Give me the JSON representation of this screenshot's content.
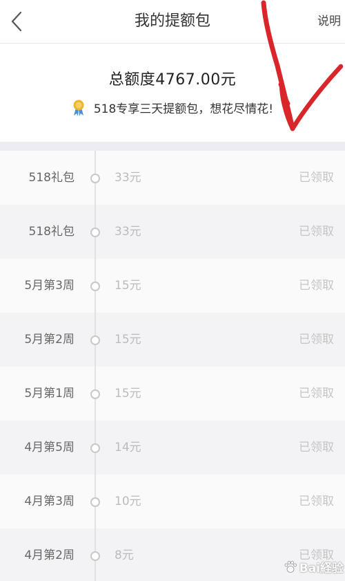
{
  "navbar": {
    "back_icon": "chevron-left-icon",
    "title": "我的提额包",
    "help_label": "说明"
  },
  "summary": {
    "total_label": "总额度4767.00元",
    "promo_icon": "medal-icon",
    "promo_text": "518专享三天提额包，想花尽情花!"
  },
  "packages": [
    {
      "label": "518礼包",
      "amount": "33元",
      "status": "已领取"
    },
    {
      "label": "518礼包",
      "amount": "33元",
      "status": "已领取"
    },
    {
      "label": "5月第3周",
      "amount": "15元",
      "status": "已领取"
    },
    {
      "label": "5月第2周",
      "amount": "15元",
      "status": "已领取"
    },
    {
      "label": "5月第1周",
      "amount": "15元",
      "status": "已领取"
    },
    {
      "label": "4月第5周",
      "amount": "14元",
      "status": "已领取"
    },
    {
      "label": "4月第3周",
      "amount": "10元",
      "status": "已领取"
    },
    {
      "label": "4月第2周",
      "amount": "8元",
      "status": "已领取"
    }
  ],
  "annotation": {
    "type": "red-arrow-icon",
    "color": "#d8262a"
  },
  "watermark": {
    "text": "Bai経验"
  },
  "colors": {
    "background": "#ffffff",
    "list_bg_alt": "#f3f3f5",
    "muted_text": "#bbbbbb",
    "accent_red": "#d8262a",
    "medal_gold": "#f0b429",
    "medal_ribbon": "#4a90d9"
  }
}
